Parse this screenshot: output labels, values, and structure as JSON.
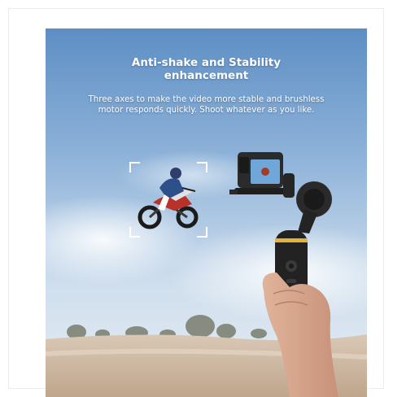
{
  "banner": {
    "headline_line1": "Anti-shake and Stability",
    "headline_line2": "enhancement",
    "subtext_line1": "Three axes to make the video more stable and brushless",
    "subtext_line2": "motor responds quickly. Shoot whatever as you like."
  },
  "colors": {
    "sky_top": "#5e8fc4",
    "sky_mid": "#a9c6e2",
    "sky_bottom": "#dfe8ef",
    "ground": "#cdb9a3",
    "accent_ring": "#e3b23c"
  },
  "icons": {
    "focus": "focus-bracket-icon",
    "camera": "action-camera-icon",
    "gimbal": "gimbal-icon"
  }
}
